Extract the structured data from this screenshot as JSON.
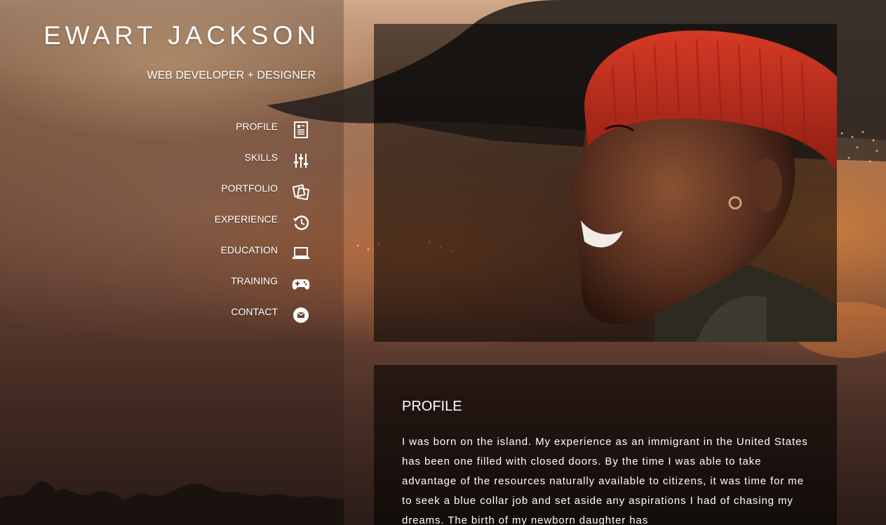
{
  "header": {
    "name": "EWART JACKSON",
    "tagline": "WEB DEVELOPER + DESIGNER"
  },
  "nav": {
    "items": [
      {
        "label": "PROFILE",
        "icon": "document-icon"
      },
      {
        "label": "SKILLS",
        "icon": "sliders-icon"
      },
      {
        "label": "PORTFOLIO",
        "icon": "photos-icon"
      },
      {
        "label": "EXPERIENCE",
        "icon": "history-icon"
      },
      {
        "label": "EDUCATION",
        "icon": "laptop-icon"
      },
      {
        "label": "TRAINING",
        "icon": "gamepad-icon"
      },
      {
        "label": "CONTACT",
        "icon": "mail-icon"
      }
    ]
  },
  "profile": {
    "heading": "PROFILE",
    "text": "I was born on the island. My experience as an immigrant in the United States has been one filled with closed doors. By the time I was able to take advantage of the resources naturally available to citizens, it was time for me to seek a blue collar job and set aside any aspirations I had of chasing my dreams. The birth of my newborn daughter has"
  },
  "colors": {
    "accent_hat": "#c0291c",
    "card_bg": "#000000"
  }
}
